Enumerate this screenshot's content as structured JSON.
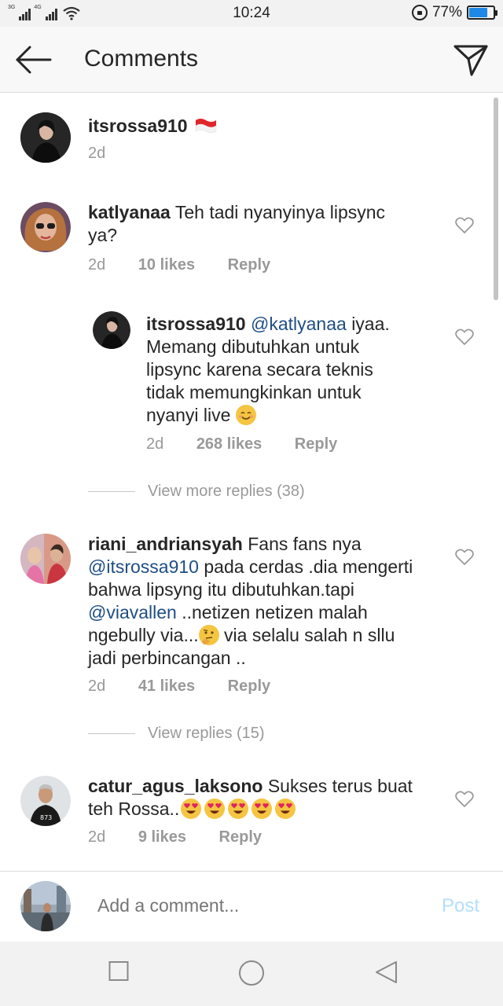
{
  "status_bar": {
    "network_1": "3G",
    "network_2": "4G",
    "time": "10:24",
    "battery_percent": "77%",
    "battery_level": 0.77
  },
  "header": {
    "title": "Comments",
    "back_icon": "arrow-left-icon",
    "send_icon": "direct-send-icon"
  },
  "caption": {
    "username": "itsrossa910",
    "flag": "indonesia-flag-icon",
    "time": "2d"
  },
  "comments": [
    {
      "username": "katlyanaa",
      "text": "Teh tadi nyanyinya lipsync ya?",
      "time": "2d",
      "likes": "10 likes",
      "reply_label": "Reply",
      "reply": {
        "username": "itsrossa910",
        "mention": "@katlyanaa",
        "text": "iyaa. Memang dibutuhkan untuk lipsync  karena secara teknis tidak memungkinkan untuk nyanyi live",
        "emoji": "smiling-face-emoji",
        "time": "2d",
        "likes": "268 likes",
        "reply_label": "Reply"
      },
      "view_more": "View more replies (38)"
    },
    {
      "username": "riani_andriansyah",
      "text_1": "Fans fans nya",
      "mention_1": "@itsrossa910",
      "text_2": " pada cerdas .dia mengerti bahwa lipsyng itu dibutuhkan.tapi ",
      "mention_2": "@viavallen",
      "text_3": " ..netizen netizen malah ngebully via...",
      "emoji": "thinking-face-emoji",
      "text_4": " via selalu salah n sllu jadi perbincangan ..",
      "time": "2d",
      "likes": "41 likes",
      "reply_label": "Reply",
      "view_more": "View replies (15)"
    },
    {
      "username": "catur_agus_laksono",
      "text": "Sukses terus buat teh Rossa..",
      "emoji": "heart-eyes-emoji",
      "emoji_count": 5,
      "time": "2d",
      "likes": "9 likes",
      "reply_label": "Reply"
    }
  ],
  "add_comment": {
    "placeholder": "Add a comment...",
    "post_label": "Post"
  },
  "nav_bar": {
    "recents_icon": "square-icon",
    "home_icon": "circle-icon",
    "back_icon": "triangle-back-icon"
  },
  "colors": {
    "mention": "#1f4e84",
    "meta_gray": "#999999",
    "post_disabled": "#b2dffc",
    "battery": "#1e88e5"
  }
}
